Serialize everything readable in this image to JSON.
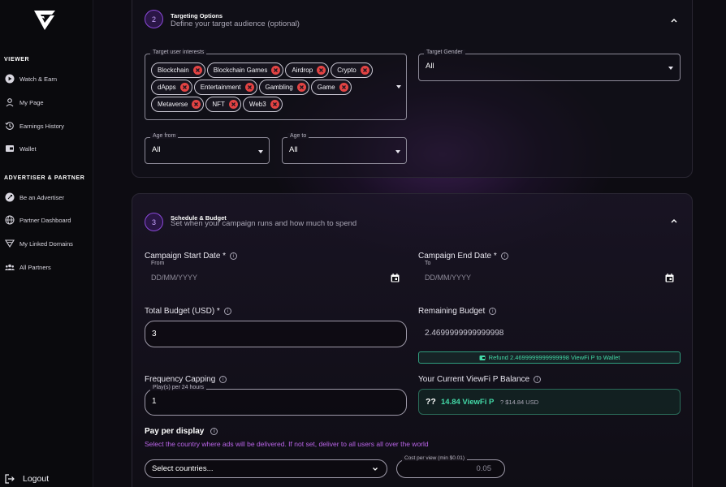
{
  "sidebar": {
    "logo": "viewfi-logo",
    "viewer_title": "VIEWER",
    "viewer_items": [
      {
        "label": "Watch & Earn",
        "icon": "play-circle-icon"
      },
      {
        "label": "My Page",
        "icon": "person-icon"
      },
      {
        "label": "Earnings History",
        "icon": "history-icon"
      },
      {
        "label": "Wallet",
        "icon": "wallet-icon"
      }
    ],
    "advertiser_title": "ADVERTISER & PARTNER",
    "advertiser_items": [
      {
        "label": "Be an Advertiser",
        "icon": "rocket-icon"
      },
      {
        "label": "Partner Dashboard",
        "icon": "globe-icon"
      },
      {
        "label": "My Linked Domains",
        "icon": "domain-icon"
      },
      {
        "label": "All Partners",
        "icon": "group-icon"
      }
    ],
    "logout_label": "Logout"
  },
  "targeting": {
    "step": "2",
    "title": "Targeting Options",
    "subtitle": "Define your target audience (optional)",
    "interests_legend": "Target user interests",
    "interests": [
      "Blockchain",
      "Blockchain Games",
      "Airdrop",
      "Crypto",
      "dApps",
      "Entertainment",
      "Gambling",
      "Game",
      "Metaverse",
      "NFT",
      "Web3"
    ],
    "gender_legend": "Target Gender",
    "gender_value": "All",
    "age_from_legend": "Age from",
    "age_from_value": "All",
    "age_to_legend": "Age to",
    "age_to_value": "All"
  },
  "schedule": {
    "step": "3",
    "title": "Schedule & Budget",
    "subtitle": "Set when your campaign runs and how much to spend",
    "start_label": "Campaign Start Date *",
    "start_legend": "From",
    "start_placeholder": "DD/MM/YYYY",
    "end_label": "Campaign End Date *",
    "end_legend": "To",
    "end_placeholder": "DD/MM/YYYY",
    "total_budget_label": "Total Budget (USD) *",
    "total_budget_value": "3",
    "remaining_label": "Remaining Budget",
    "remaining_value": "2.4699999999999998",
    "refund_label": "Refund 2.4699999999999998 ViewFi P to Wallet",
    "frequency_label": "Frequency Capping",
    "frequency_legend": "Play(s) per 24 hours",
    "frequency_value": "1",
    "balance_label": "Your Current ViewFi P Balance",
    "balance_prefix": "??",
    "balance_amount": "14.84 ViewFi P",
    "balance_usd": "? $14.84 USD",
    "ppd_label": "Pay per display",
    "ppd_hint": "Select the country where ads will be delivered. If not set, deliver to all users all over the world",
    "countries_placeholder": "Select countries...",
    "cpv_legend": "Cost per view (min $0.01)",
    "cpv_placeholder": "0.05"
  },
  "colors": {
    "accent_purple": "#8b49d9",
    "chip_delete": "#e34343",
    "success_green": "#43d9a7",
    "hint_purple": "#b964e8"
  }
}
